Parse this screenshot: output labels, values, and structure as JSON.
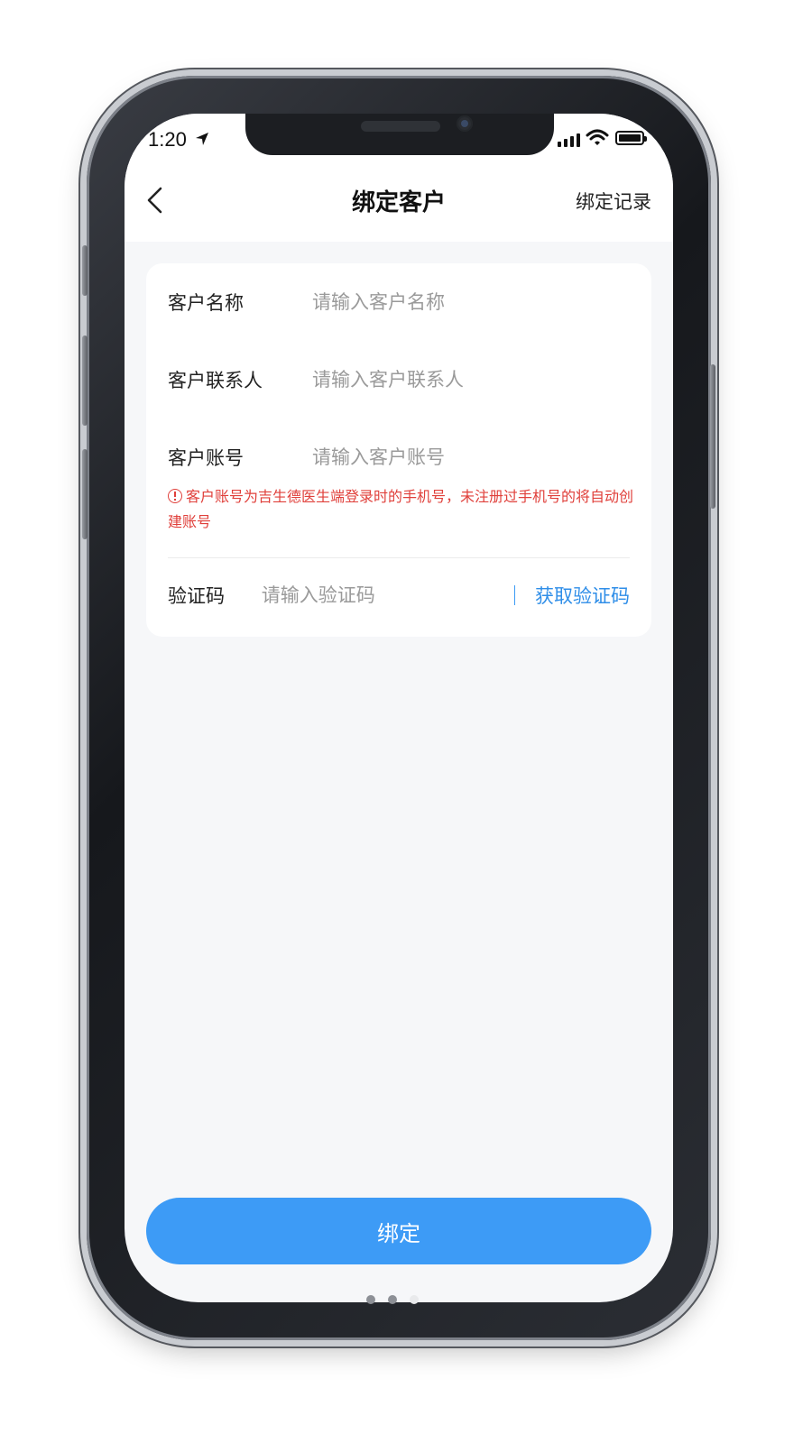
{
  "status_bar": {
    "time": "1:20",
    "icons": [
      "location-arrow-icon",
      "cellular-signal-icon",
      "wifi-icon",
      "battery-icon"
    ]
  },
  "nav": {
    "back_icon": "chevron-left-icon",
    "title": "绑定客户",
    "right_link": "绑定记录"
  },
  "form": {
    "customer_name": {
      "label": "客户名称",
      "placeholder": "请输入客户名称",
      "value": ""
    },
    "contact_person": {
      "label": "客户联系人",
      "placeholder": "请输入客户联系人",
      "value": ""
    },
    "account": {
      "label": "客户账号",
      "placeholder": "请输入客户账号",
      "value": "",
      "hint": "客户账号为吉生德医生端登录时的手机号，未注册过手机号的将自动创建账号"
    },
    "verify_code": {
      "label": "验证码",
      "placeholder": "请输入验证码",
      "value": "",
      "get_code_label": "获取验证码"
    }
  },
  "bind_button": {
    "label": "绑定"
  },
  "colors": {
    "accent": "#3d9bf6",
    "link": "#2f8ee8",
    "error": "#e0403b",
    "background": "#f6f7f9"
  }
}
